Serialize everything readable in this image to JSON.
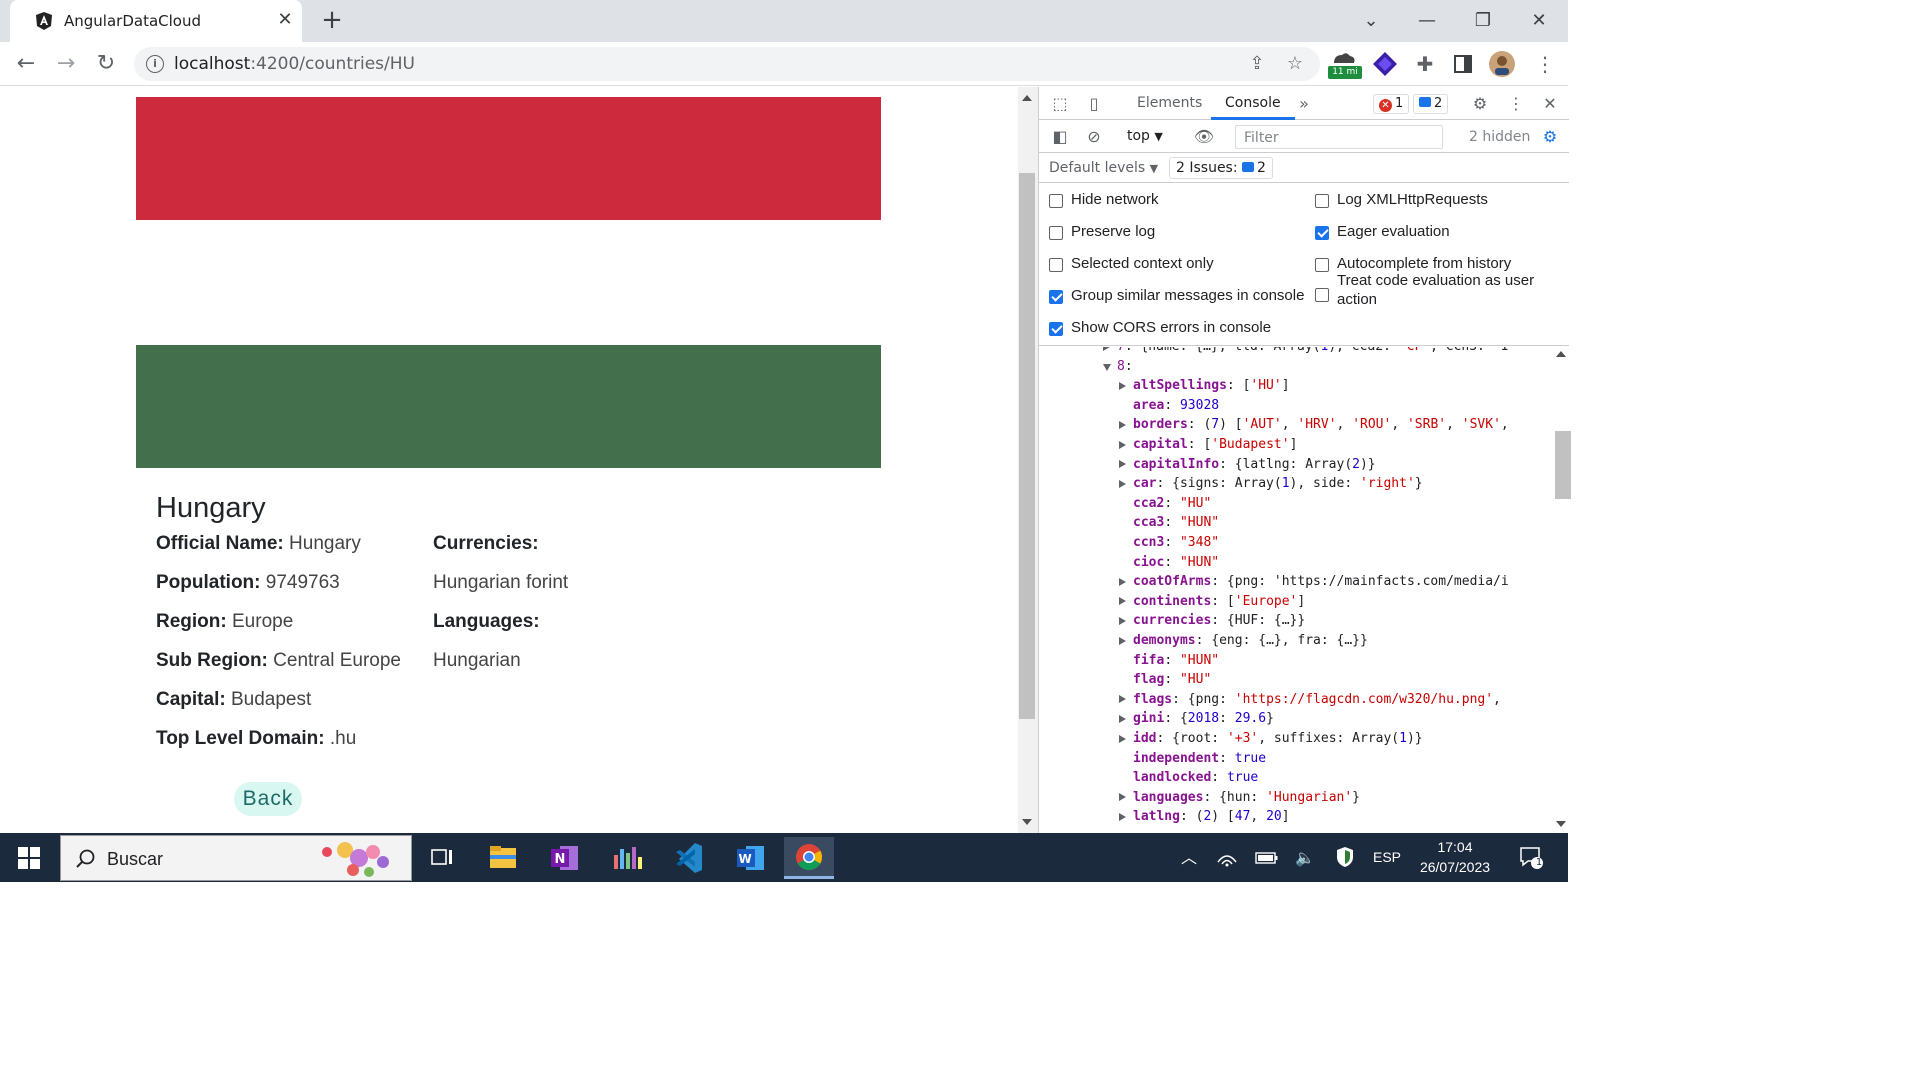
{
  "browser": {
    "tab_title": "AngularDataCloud",
    "url_host": "localhost",
    "url_path": ":4200/countries/HU",
    "extension_badge": "11 mi"
  },
  "country": {
    "flag_colors": [
      "#CD2A3E",
      "#FFFFFF",
      "#436F4D"
    ],
    "name": "Hungary",
    "fields": [
      {
        "label": "Official Name:",
        "value": "Hungary"
      },
      {
        "label": "Population:",
        "value": "9749763"
      },
      {
        "label": "Region:",
        "value": "Europe"
      },
      {
        "label": "Sub Region:",
        "value": "Central Europe"
      },
      {
        "label": "Capital:",
        "value": "Budapest"
      },
      {
        "label": "Top Level Domain:",
        "value": ".hu"
      }
    ],
    "currencies_label": "Currencies:",
    "currencies_value": "Hungarian forint",
    "languages_label": "Languages:",
    "languages_value": "Hungarian",
    "back_label": "Back"
  },
  "devtools": {
    "tabs": [
      "Elements",
      "Console"
    ],
    "error_count": "1",
    "message_count": "2",
    "context": "top",
    "filter_placeholder": "Filter",
    "hidden_count": "2 hidden",
    "levels_label": "Default levels",
    "issues_label": "2 Issues:",
    "issues_count": "2",
    "settings": [
      {
        "label": "Hide network",
        "checked": false
      },
      {
        "label": "Log XMLHttpRequests",
        "checked": false
      },
      {
        "label": "Preserve log",
        "checked": false
      },
      {
        "label": "Eager evaluation",
        "checked": true
      },
      {
        "label": "Selected context only",
        "checked": false
      },
      {
        "label": "Autocomplete from history",
        "checked": false
      },
      {
        "label": "Group similar messages in console",
        "checked": true
      },
      {
        "label": "Treat code evaluation as user action",
        "checked": false
      },
      {
        "label": "Show CORS errors in console",
        "checked": true
      }
    ],
    "console_lines": [
      "7: {name: {…}, tld: Array(1), cca2: 'CF', ccn3: '1",
      "8:",
      "altSpellings: ['HU']",
      "area: 93028",
      "borders: (7) ['AUT', 'HRV', 'ROU', 'SRB', 'SVK',",
      "capital: ['Budapest']",
      "capitalInfo: {latlng: Array(2)}",
      "car: {signs: Array(1), side: 'right'}",
      "cca2: \"HU\"",
      "cca3: \"HUN\"",
      "ccn3: \"348\"",
      "cioc: \"HUN\"",
      "coatOfArms: {png: 'https://mainfacts.com/media/i",
      "continents: ['Europe']",
      "currencies: {HUF: {…}}",
      "demonyms: {eng: {…}, fra: {…}}",
      "fifa: \"HUN\"",
      "flag: \"HU\"",
      "flags: {png: 'https://flagcdn.com/w320/hu.png',",
      "gini: {2018: 29.6}",
      "idd: {root: '+3', suffixes: Array(1)}",
      "independent: true",
      "landlocked: true",
      "languages: {hun: 'Hungarian'}",
      "latlng: (2) [47, 20]"
    ]
  },
  "taskbar": {
    "search_placeholder": "Buscar",
    "language": "ESP",
    "time": "17:04",
    "date": "26/07/2023",
    "notification_count": "1"
  }
}
